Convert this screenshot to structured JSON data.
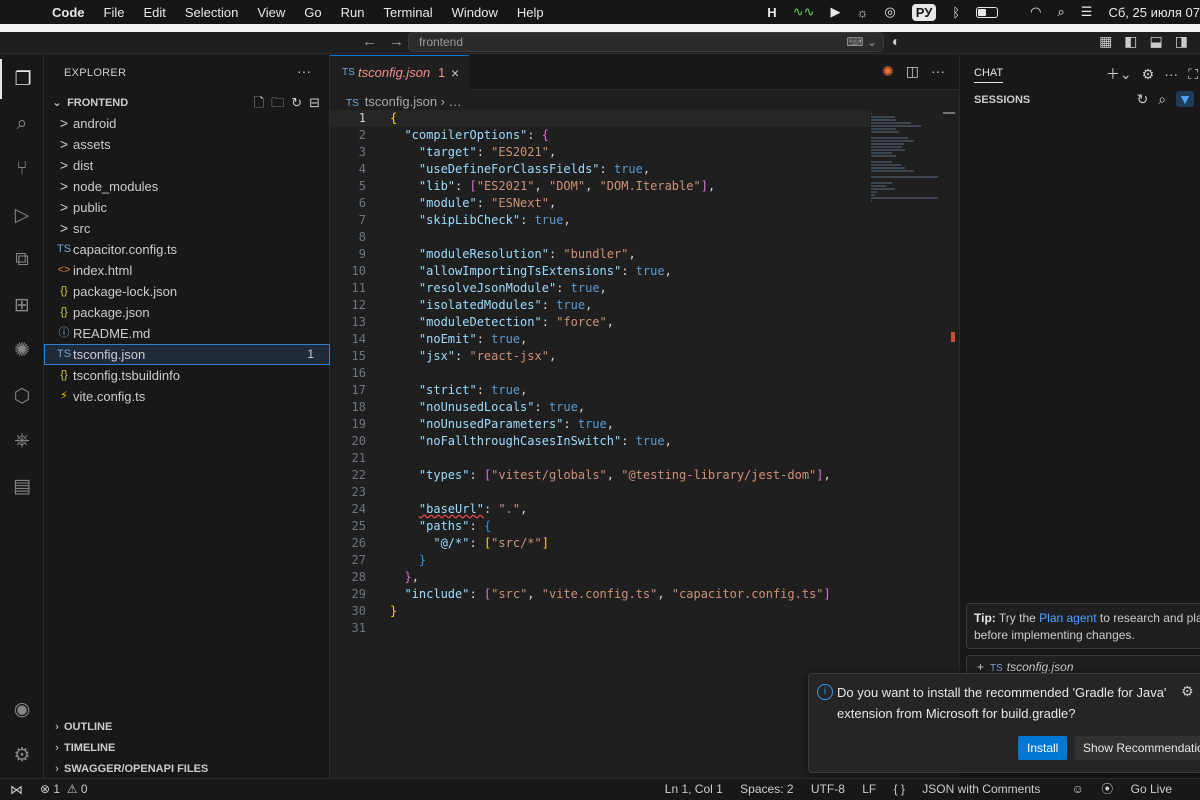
{
  "menubar": {
    "app": "Code",
    "items": [
      "File",
      "Edit",
      "Selection",
      "View",
      "Go",
      "Run",
      "Terminal",
      "Window",
      "Help"
    ],
    "keyboard_layout": "РУ",
    "datetime": "Сб, 25 июля 07"
  },
  "titlebar": {
    "search_text": "frontend"
  },
  "activity_bar": {
    "icons": [
      "files-icon",
      "search-icon",
      "source-control-icon",
      "run-debug-icon",
      "remote-explorer-icon",
      "extensions-icon",
      "copilot-icon",
      "package-icon",
      "kubernetes-icon",
      "notebook-icon",
      "account-icon",
      "settings-gear-icon"
    ]
  },
  "explorer": {
    "header": "EXPLORER",
    "folder": "FRONTEND",
    "items": [
      {
        "name": "android",
        "type": "folder",
        "icon": ">"
      },
      {
        "name": "assets",
        "type": "folder",
        "icon": ">"
      },
      {
        "name": "dist",
        "type": "folder",
        "icon": ">"
      },
      {
        "name": "node_modules",
        "type": "folder",
        "icon": ">"
      },
      {
        "name": "public",
        "type": "folder",
        "icon": ">"
      },
      {
        "name": "src",
        "type": "folder",
        "icon": ">"
      },
      {
        "name": "capacitor.config.ts",
        "type": "ts",
        "icon": "TS"
      },
      {
        "name": "index.html",
        "type": "html",
        "icon": "<>"
      },
      {
        "name": "package-lock.json",
        "type": "json",
        "icon": "{}"
      },
      {
        "name": "package.json",
        "type": "json",
        "icon": "{}"
      },
      {
        "name": "README.md",
        "type": "info",
        "icon": "ⓘ"
      },
      {
        "name": "tsconfig.json",
        "type": "tsconfig",
        "icon": "TS",
        "selected": true,
        "problems": "1"
      },
      {
        "name": "tsconfig.tsbuildinfo",
        "type": "json",
        "icon": "{}"
      },
      {
        "name": "vite.config.ts",
        "type": "vite",
        "icon": "⚡"
      }
    ],
    "sections": [
      "OUTLINE",
      "TIMELINE",
      "SWAGGER/OPENAPI FILES"
    ]
  },
  "editor": {
    "tab": {
      "label": "tsconfig.json",
      "problems": "1"
    },
    "breadcrumb": {
      "file": "tsconfig.json",
      "rest": "…"
    },
    "lines": [
      "{",
      "  \"compilerOptions\": {",
      "    \"target\": \"ES2021\",",
      "    \"useDefineForClassFields\": true,",
      "    \"lib\": [\"ES2021\", \"DOM\", \"DOM.Iterable\"],",
      "    \"module\": \"ESNext\",",
      "    \"skipLibCheck\": true,",
      "",
      "    \"moduleResolution\": \"bundler\",",
      "    \"allowImportingTsExtensions\": true,",
      "    \"resolveJsonModule\": true,",
      "    \"isolatedModules\": true,",
      "    \"moduleDetection\": \"force\",",
      "    \"noEmit\": true,",
      "    \"jsx\": \"react-jsx\",",
      "",
      "    \"strict\": true,",
      "    \"noUnusedLocals\": true,",
      "    \"noUnusedParameters\": true,",
      "    \"noFallthroughCasesInSwitch\": true,",
      "",
      "    \"types\": [\"vitest/globals\", \"@testing-library/jest-dom\"],",
      "",
      "    \"baseUrl\": \".\",",
      "    \"paths\": {",
      "      \"@/*\": [\"src/*\"]",
      "    }",
      "  },",
      "  \"include\": [\"src\", \"vite.config.ts\", \"capacitor.config.ts\"]",
      "}",
      ""
    ]
  },
  "chat": {
    "tab": "CHAT",
    "sessions_label": "SESSIONS",
    "tip": {
      "bold": "Tip:",
      "before": "Try the",
      "link": "Plan agent",
      "after": "to research and pla",
      "line2": "before implementing changes."
    },
    "attachment": "tsconfig.json"
  },
  "notification": {
    "message": "Do you want to install the recommended 'Gradle for Java' extension from Microsoft for build.gradle?",
    "primary": "Install",
    "secondary": "Show Recommendations"
  },
  "statusbar": {
    "errors": "1",
    "warnings": "0",
    "position": "Ln 1, Col 1",
    "spaces": "Spaces: 2",
    "encoding": "UTF-8",
    "eol": "LF",
    "language": "JSON with Comments",
    "golive": "Go Live"
  }
}
